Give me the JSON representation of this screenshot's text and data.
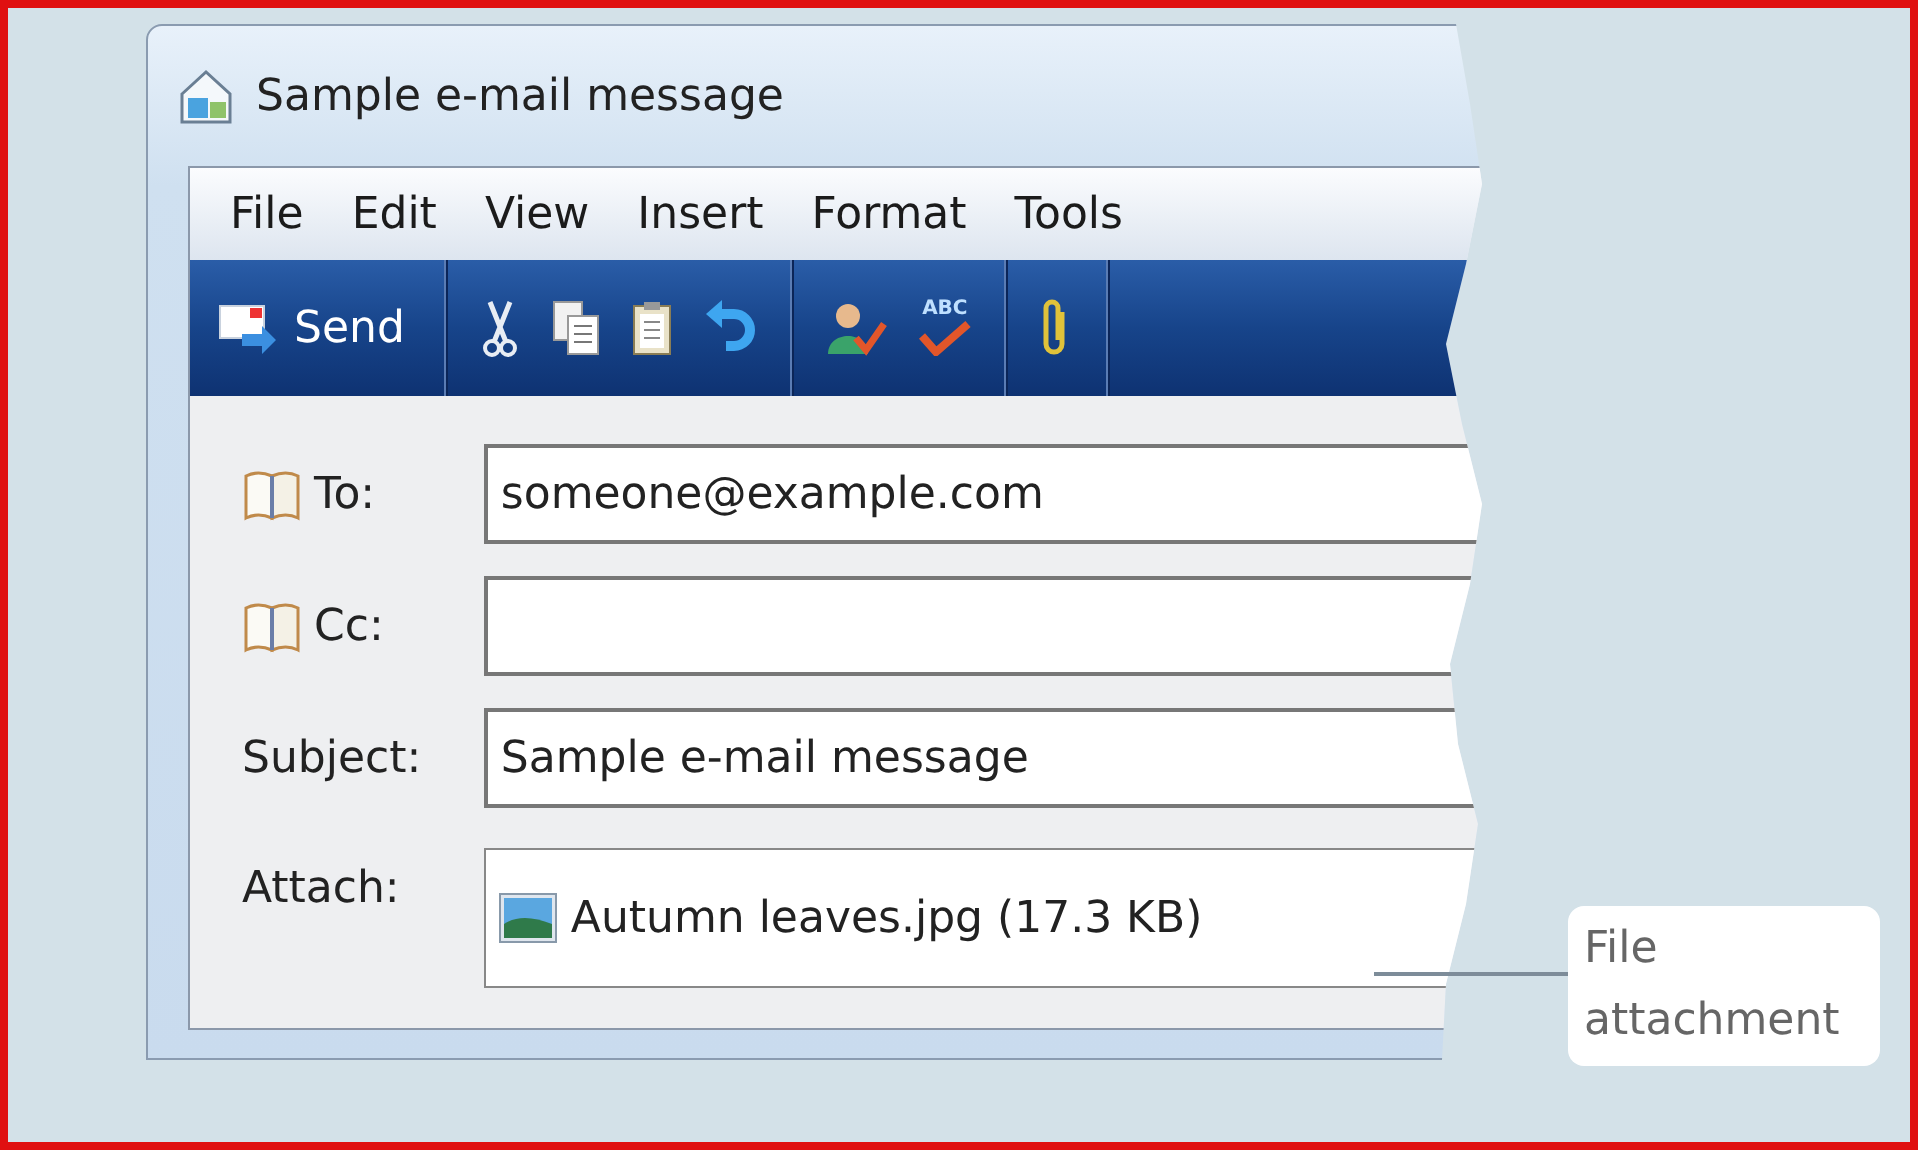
{
  "window": {
    "title": "Sample e-mail message"
  },
  "menu": [
    "File",
    "Edit",
    "View",
    "Insert",
    "Format",
    "Tools"
  ],
  "toolbar": {
    "groups": [
      [
        {
          "kind": "send",
          "label": "Send"
        }
      ],
      [
        {
          "kind": "cut"
        },
        {
          "kind": "copy"
        },
        {
          "kind": "paste"
        },
        {
          "kind": "undo"
        }
      ],
      [
        {
          "kind": "contacts"
        },
        {
          "kind": "spelling",
          "label": "ABC"
        }
      ],
      [
        {
          "kind": "attach"
        }
      ]
    ]
  },
  "fields": [
    {
      "kind": "address",
      "label": "To:",
      "value": "someone@example.com"
    },
    {
      "kind": "address",
      "label": "Cc:"
    },
    {
      "kind": "text",
      "label": "Subject:",
      "value": "Sample e-mail message"
    },
    {
      "kind": "attachment",
      "label": "Attach:",
      "file": "Autumn leaves.jpg (17.3 KB)"
    }
  ],
  "callout": {
    "text": "File attachment"
  }
}
